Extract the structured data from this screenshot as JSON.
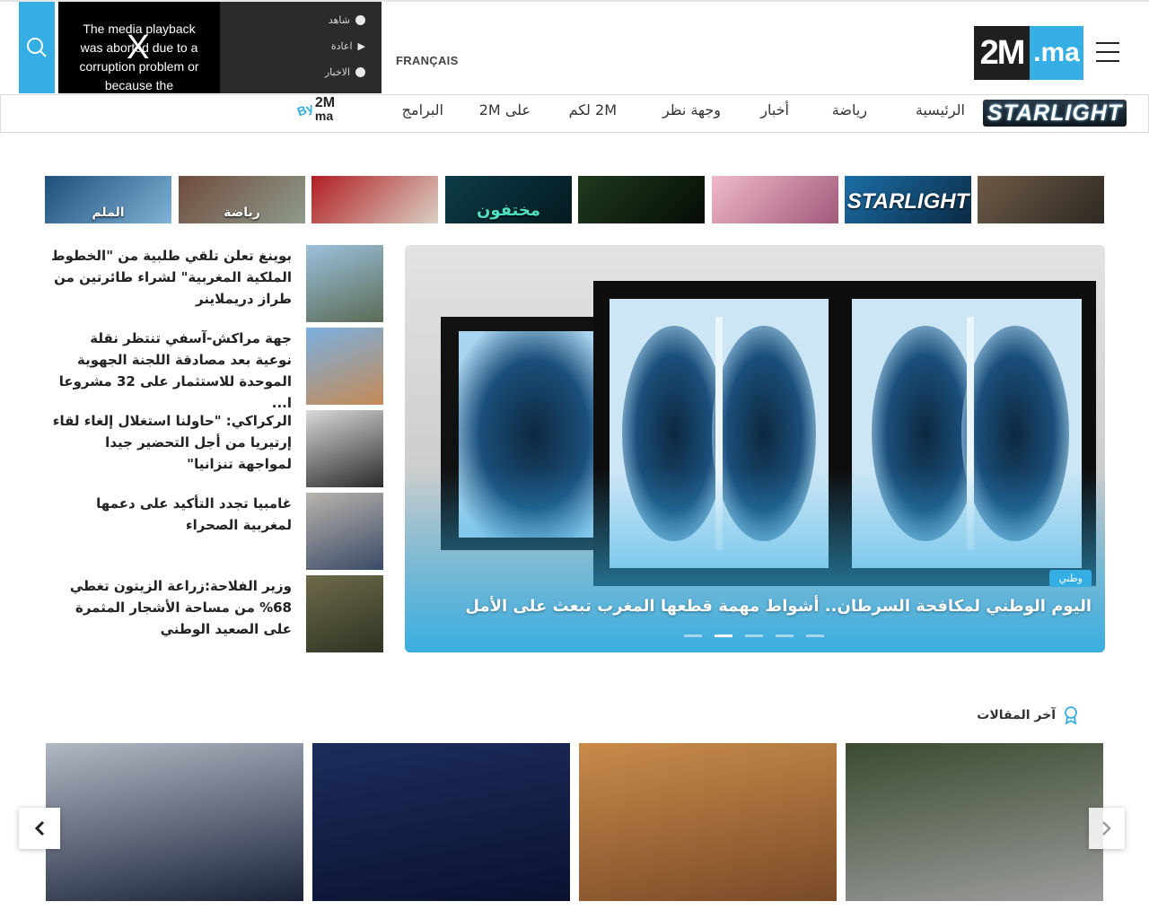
{
  "header": {
    "logo": {
      "black_part": "2M",
      "blue_part": ".ma"
    },
    "language_link": "FRANÇAIS",
    "player": {
      "error_message": "The media playback was aborted due to a corruption problem or because the",
      "close": "X",
      "menu": [
        {
          "label": "شاهد"
        },
        {
          "label": "اعادة"
        },
        {
          "label": "الاخبار"
        }
      ]
    }
  },
  "nav": {
    "brand": "STARLIGHT",
    "items": [
      {
        "label": "الرئيسية"
      },
      {
        "label": "رياضة"
      },
      {
        "label": "أخبار"
      },
      {
        "label": "وجهة نظر"
      },
      {
        "label": "2M لكم"
      },
      {
        "label": "على 2M"
      },
      {
        "label": "البرامج"
      }
    ],
    "by2m": {
      "by": "By",
      "top": "2M",
      "bottom": "ma"
    }
  },
  "strip": [
    {
      "label": "",
      "colors": [
        "#6e5a45",
        "#2e2a24"
      ]
    },
    {
      "label": "STARLIGHT",
      "colors": [
        "#1b6fa8",
        "#0b2a44"
      ]
    },
    {
      "label": "",
      "colors": [
        "#f0b9c9",
        "#a05a7a"
      ]
    },
    {
      "label": "",
      "colors": [
        "#1f3a1e",
        "#060d06"
      ]
    },
    {
      "label": "مختفون",
      "colors": [
        "#0d3c48",
        "#041a20"
      ]
    },
    {
      "label": "",
      "colors": [
        "#b21e24",
        "#d9d0c2"
      ]
    },
    {
      "label": "رياضة",
      "colors": [
        "#6f4b3c",
        "#8f9c8c"
      ]
    },
    {
      "label": "الملم",
      "colors": [
        "#1e4f7a",
        "#7fb2d6"
      ]
    }
  ],
  "side_news": [
    {
      "title": "بوينغ تعلن تلقي طلبية من \"الخطوط الملكية المغربية\" لشراء طائرتين من طراز دريملاينر",
      "colors": [
        "#9cc1dd",
        "#5a6b55"
      ]
    },
    {
      "title": "جهة مراكش-آسفي تنتظر نقلة نوعية بعد مصادقة اللجنة الجهوية الموحدة للاستثمار على 32 مشروعا ا...",
      "colors": [
        "#7ab0e0",
        "#c68a55"
      ]
    },
    {
      "title": "الركراكي: \"حاولنا استغلال إلغاء لقاء إرتيريا من أجل التحضير جيدا لمواجهة تنزانيا\"",
      "colors": [
        "#d9d9d9",
        "#2a2a2a"
      ]
    },
    {
      "title": "غامبيا تجدد التأكيد على دعمها لمغربية الصحراء",
      "colors": [
        "#b9b4ad",
        "#3a4a66"
      ]
    },
    {
      "title": "وزير الفلاحة:زراعة الزيتون  تغطي 68% من مساحة الأشجار المثمرة على الصعيد الوطني",
      "colors": [
        "#6e6a4a",
        "#2f3322"
      ]
    }
  ],
  "hero": {
    "category": "وطني",
    "title": "اليوم الوطني لمكافحة السرطان.. أشواط مهمة قطعها المغرب تبعث على الأمل",
    "slides": 5,
    "active_slide": 2
  },
  "latest": {
    "heading": "آخر المقالات",
    "cards": [
      {
        "colors": [
          "#3a4b2f",
          "#9c9c9c"
        ]
      },
      {
        "colors": [
          "#c98b4a",
          "#7a4a28"
        ]
      },
      {
        "colors": [
          "#1c2d5c",
          "#0a1230"
        ]
      },
      {
        "colors": [
          "#b0b8c4",
          "#1a2238"
        ]
      }
    ]
  },
  "colors": {
    "accent": "#34aee3",
    "dark": "#1f1f1f"
  }
}
